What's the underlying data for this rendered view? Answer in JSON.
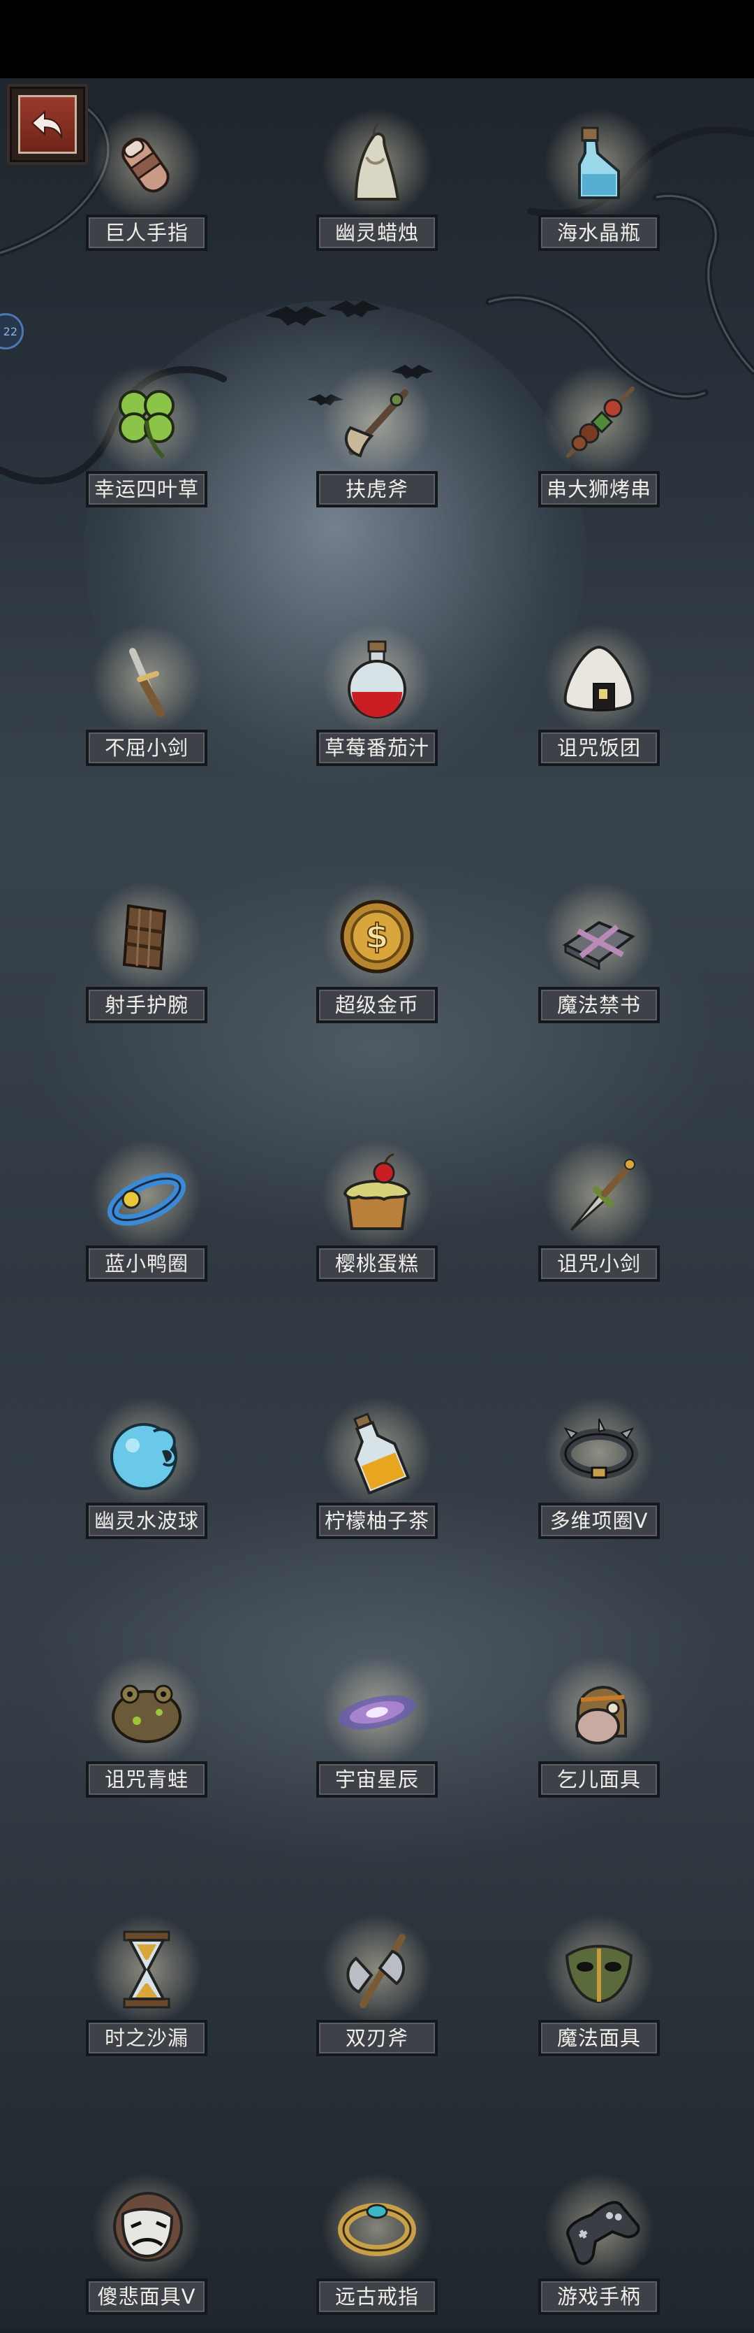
{
  "side_badge": "22",
  "items": [
    {
      "name": "巨人手指",
      "icon": "giant-finger-icon"
    },
    {
      "name": "幽灵蜡烛",
      "icon": "ghost-candle-icon"
    },
    {
      "name": "海水晶瓶",
      "icon": "sea-crystal-bottle-icon"
    },
    {
      "name": "幸运四叶草",
      "icon": "four-leaf-clover-icon"
    },
    {
      "name": "扶虎斧",
      "icon": "tiger-axe-icon"
    },
    {
      "name": "串大狮烤串",
      "icon": "kebab-skewer-icon"
    },
    {
      "name": "不屈小剑",
      "icon": "small-sword-icon"
    },
    {
      "name": "草莓番茄汁",
      "icon": "red-potion-icon"
    },
    {
      "name": "诅咒饭团",
      "icon": "rice-ball-icon"
    },
    {
      "name": "射手护腕",
      "icon": "archer-bracer-icon"
    },
    {
      "name": "超级金币",
      "icon": "gold-coin-icon"
    },
    {
      "name": "魔法禁书",
      "icon": "forbidden-book-icon"
    },
    {
      "name": "蓝小鸭圈",
      "icon": "duck-ring-icon"
    },
    {
      "name": "樱桃蛋糕",
      "icon": "cherry-cake-icon"
    },
    {
      "name": "诅咒小剑",
      "icon": "cursed-dagger-icon"
    },
    {
      "name": "幽灵水波球",
      "icon": "water-orb-icon"
    },
    {
      "name": "柠檬柚子茶",
      "icon": "lemon-tea-bottle-icon"
    },
    {
      "name": "多维项圈V",
      "icon": "spiked-collar-icon"
    },
    {
      "name": "诅咒青蛙",
      "icon": "cursed-frog-icon"
    },
    {
      "name": "宇宙星辰",
      "icon": "galaxy-icon"
    },
    {
      "name": "乞儿面具",
      "icon": "beggar-mask-icon"
    },
    {
      "name": "时之沙漏",
      "icon": "hourglass-icon"
    },
    {
      "name": "双刃斧",
      "icon": "double-axe-icon"
    },
    {
      "name": "魔法面具",
      "icon": "magic-mask-icon"
    },
    {
      "name": "傻悲面具V",
      "icon": "sad-mask-icon"
    },
    {
      "name": "远古戒指",
      "icon": "ancient-ring-icon"
    },
    {
      "name": "游戏手柄",
      "icon": "gamepad-icon"
    }
  ]
}
